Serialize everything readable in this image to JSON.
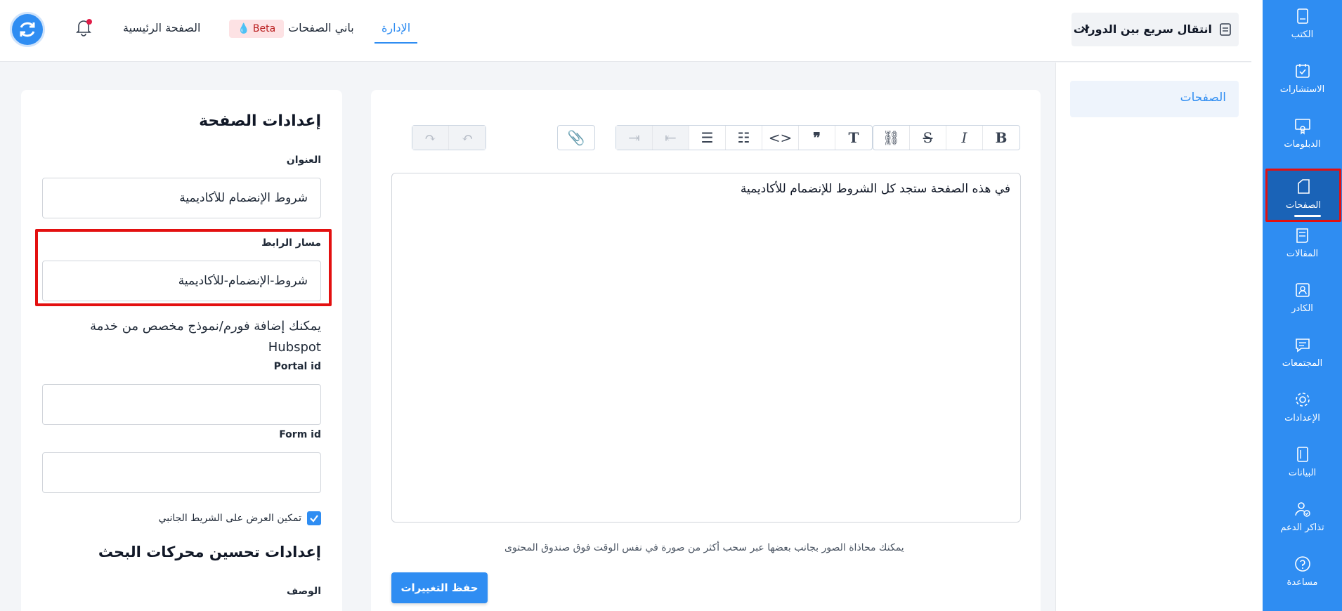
{
  "topbar": {
    "home_label": "الصفحة الرئيسية",
    "builder_label": "باني الصفحات",
    "beta_label": "Beta",
    "admin_label": "الإدارة",
    "course_switch_label": "انتقال سريع بين الدورات"
  },
  "sidebar": {
    "items": [
      {
        "label": "الكتب",
        "icon": "book-icon"
      },
      {
        "label": "الاستشارات",
        "icon": "calendar-check-icon"
      },
      {
        "label": "الدبلومات",
        "icon": "certificate-icon"
      },
      {
        "label": "الصفحات",
        "icon": "pages-icon",
        "active": true
      },
      {
        "label": "المقالات",
        "icon": "articles-icon"
      },
      {
        "label": "الكادر",
        "icon": "staff-icon"
      },
      {
        "label": "المجتمعات",
        "icon": "chat-icon"
      },
      {
        "label": "الإعدادات",
        "icon": "gear-icon"
      },
      {
        "label": "البيانات",
        "icon": "data-icon"
      },
      {
        "label": "تذاكر الدعم",
        "icon": "support-ticket-icon"
      },
      {
        "label": "مساعدة",
        "icon": "help-icon"
      }
    ]
  },
  "pages_panel": {
    "item_label": "الصفحات"
  },
  "editor": {
    "content": "في هذه الصفحة ستجد كل الشروط للإنضمام للأكاديمية",
    "hint": "يمكنك محاذاة الصور بجانب بعضها عبر سحب أكثر من صورة في نفس الوقت فوق صندوق المحتوى",
    "save_label": "حفظ التغييرات"
  },
  "settings": {
    "title": "إعدادات الصفحة",
    "title_field_label": "العنوان",
    "title_value": "شروط الإنضمام للأكاديمية",
    "slug_label": "مسار الرابط",
    "slug_value": "شروط-الإنضمام-للأكاديمية",
    "hubspot_text": "يمكنك إضافة فورم/نموذج مخصص من خدمة Hubspot",
    "portal_label": "Portal id",
    "portal_value": "",
    "form_label": "Form id",
    "form_value": "",
    "sidebar_checkbox_label": "تمكين العرض على الشريط الجانبي",
    "seo_title": "إعدادات تحسين محركات البحث",
    "description_label": "الوصف"
  },
  "colors": {
    "primary": "#2f8df2",
    "sidebar_active": "#1a63b7",
    "highlight": "#e31010"
  }
}
